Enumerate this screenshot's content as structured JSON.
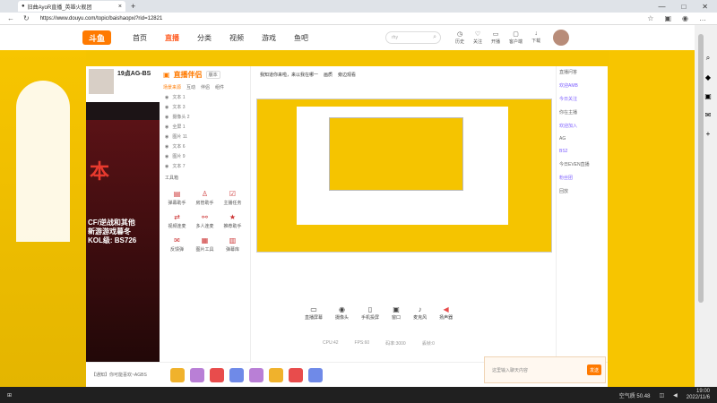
{
  "browser": {
    "tab_title": "旧曲AyoR直播_英雄火舰团",
    "url": "https://www.douyu.com/topic/baishaopxi?rid=12821",
    "window_controls": [
      "—",
      "□",
      "✕"
    ]
  },
  "site": {
    "logo": "斗鱼",
    "nav": [
      "首页",
      "直播",
      "分类",
      "视频",
      "游戏",
      "鱼吧"
    ],
    "nav_active": "直播",
    "search_placeholder": "rhy",
    "header_icons": [
      "历史",
      "关注",
      "开播",
      "客户端",
      "下载"
    ]
  },
  "inner_app": {
    "streamer_name": "19点AG-BS",
    "app_brand": "直播伴侣",
    "version_badge": "版本",
    "source_tabs": [
      "场景来源",
      "互动",
      "伴侣",
      "组件"
    ],
    "source_items": [
      "文本 1",
      "文本 3",
      "摄像头 2",
      "全屏 1",
      "图片 11",
      "文本 6",
      "图片 9",
      "文本 7"
    ],
    "tools_title": "工具箱",
    "tools": [
      "弹幕助手",
      "房管助手",
      "主播任务",
      "视频连麦",
      "多人连麦",
      "推荐助手",
      "反馈弹",
      "图片工具",
      "弹幕库"
    ],
    "preview_topbar": [
      "我知道你来啦，来以我在哪一",
      "画质",
      "旁边观看"
    ],
    "controls": [
      "直播屏幕",
      "摄像头",
      "手机投屏",
      "窗口",
      "麦克风",
      "扬声器"
    ],
    "status_line": [
      "CPU:42",
      "FPS:60",
      "码率:3000",
      "丢帧:0"
    ],
    "poster_text": [
      "CF/逆战和其他",
      "新游游戏暮冬",
      "KOL级: BS726"
    ],
    "chat_items": [
      "直播问答",
      "欢迎AMB",
      "今日关注",
      "你在主播",
      "欢迎加入",
      "AG",
      "BS2",
      "今日EVEN直播",
      "粉丝团",
      "回放"
    ],
    "send_placeholder": "这里输入聊天内容",
    "send_button": "发送",
    "bottom_tip": "【通知】你可能喜欢~AGBS"
  },
  "taskbar": {
    "weather": "空气质 50.48",
    "time": "19:00",
    "date": "2022/11/6"
  },
  "colors": {
    "brand_orange": "#ff7a00",
    "site_yellow": "#f5c400",
    "active_nav": "#ff5d23"
  }
}
